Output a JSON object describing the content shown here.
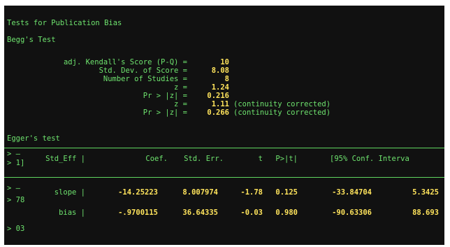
{
  "header": {
    "title": "Tests for Publication Bias",
    "begg_title": "Begg's Test",
    "egger_title": "Egger's test"
  },
  "begg": {
    "rows": [
      {
        "label": "adj. Kendall's Score (P-Q) =",
        "value": "10",
        "note": ""
      },
      {
        "label": "Std. Dev. of Score =",
        "value": "8.08",
        "note": ""
      },
      {
        "label": "Number of Studies =",
        "value": "8",
        "note": ""
      },
      {
        "label": "z =",
        "value": "1.24",
        "note": ""
      },
      {
        "label": "Pr > |z| =",
        "value": "0.216",
        "note": ""
      },
      {
        "label": "z =",
        "value": "1.11",
        "note": "(continuity corrected)"
      },
      {
        "label": "Pr > |z| =",
        "value": "0.266",
        "note": "(continuity corrected)"
      }
    ]
  },
  "egger": {
    "gutter_top": [
      "> —",
      "> 1]"
    ],
    "gutter_rows": [
      "> —",
      "> 78",
      "> 03"
    ],
    "columns": {
      "name": "Std_Eff |",
      "coef": "Coef.",
      "se": "Std. Err.",
      "t": "t",
      "p": "P>|t|",
      "ci": "[95% Conf. Interva"
    },
    "rows": [
      {
        "name": "slope |",
        "coef": "-14.25223",
        "se": "8.007974",
        "t": "-1.78",
        "p": "0.125",
        "lo": "-33.84704",
        "hi": "5.3425"
      },
      {
        "name": "bias |",
        "coef": "-.9700115",
        "se": "36.64335",
        "t": "-0.03",
        "p": "0.980",
        "lo": "-90.63306",
        "hi": "88.693"
      }
    ]
  }
}
